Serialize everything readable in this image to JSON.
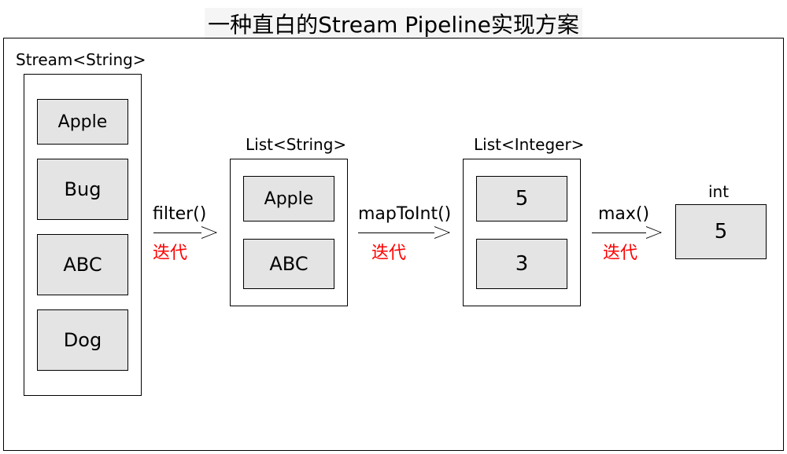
{
  "title": "一种直白的Stream Pipeline实现方案",
  "stages": [
    {
      "label": "Stream<String>",
      "items": [
        "Apple",
        "Bug",
        "ABC",
        "Dog"
      ]
    },
    {
      "label": "List<String>",
      "items": [
        "Apple",
        "ABC"
      ]
    },
    {
      "label": "List<Integer>",
      "items": [
        "5",
        "3"
      ]
    }
  ],
  "operations": [
    {
      "name": "filter()",
      "sub": "迭代"
    },
    {
      "name": "mapToInt()",
      "sub": "迭代"
    },
    {
      "name": "max()",
      "sub": "迭代"
    }
  ],
  "result": {
    "label": "int",
    "value": "5"
  }
}
